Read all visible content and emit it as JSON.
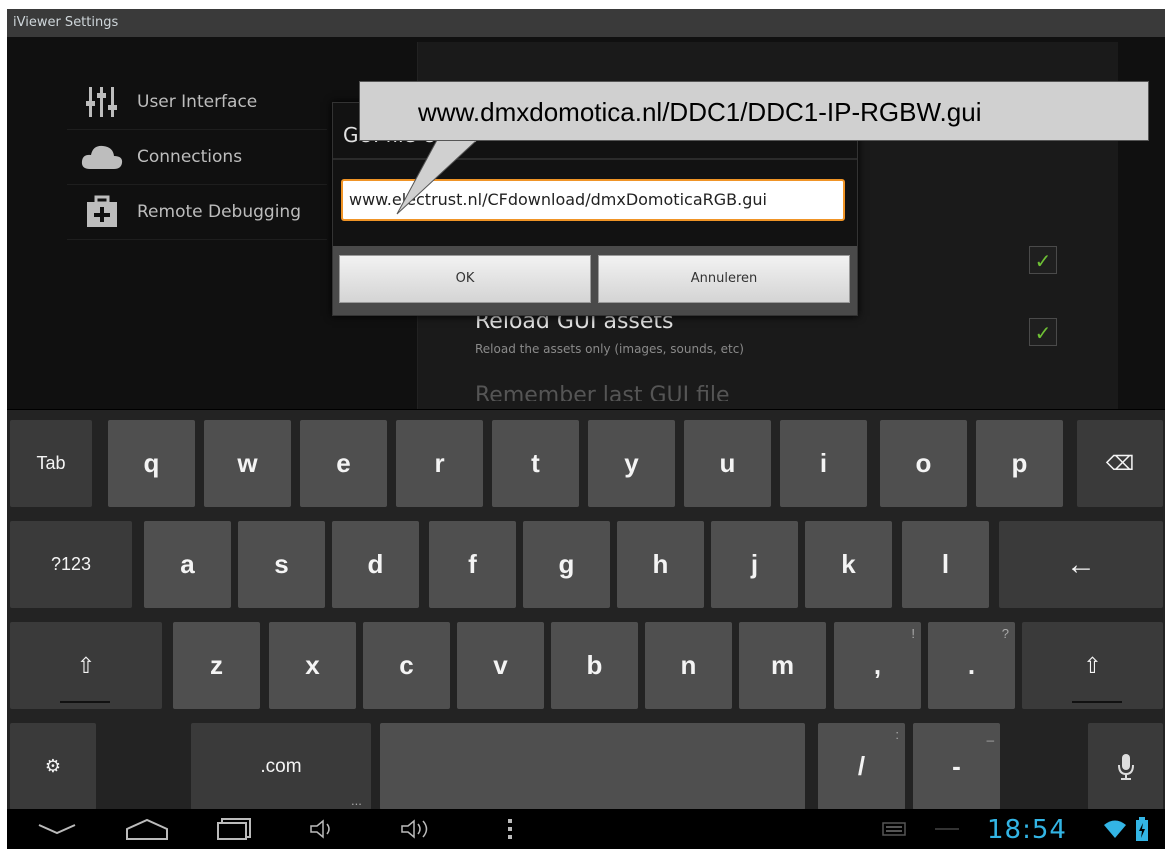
{
  "window": {
    "title": "iViewer Settings"
  },
  "sidebar": {
    "items": [
      {
        "label": "User Interface",
        "icon": "sliders-icon"
      },
      {
        "label": "Connections",
        "icon": "cloud-icon"
      },
      {
        "label": "Remote Debugging",
        "icon": "first-aid-kit-icon"
      }
    ]
  },
  "preferences": {
    "reload_title": "Reload GUI assets",
    "reload_subtitle": "Reload the assets only (images, sounds, etc)",
    "remember_title": "Remember last GUI file",
    "checkbox_mark": "✓"
  },
  "dialog": {
    "title": "GUI file URL",
    "input_value": "www.electrust.nl/CFdownload/dmxDomoticaRGB.gui",
    "ok_label": "OK",
    "cancel_label": "Annuleren"
  },
  "callout": {
    "text": "www.dmxdomotica.nl/DDC1/DDC1-IP-RGBW.gui"
  },
  "keyboard": {
    "row1": [
      "Tab",
      "q",
      "w",
      "e",
      "r",
      "t",
      "y",
      "u",
      "i",
      "o",
      "p"
    ],
    "backspace": "⌫",
    "row2": [
      "?123",
      "a",
      "s",
      "d",
      "f",
      "g",
      "h",
      "j",
      "k",
      "l"
    ],
    "enter": "←",
    "shift": "⇧",
    "row3": [
      "z",
      "x",
      "c",
      "v",
      "b",
      "n",
      "m",
      ",",
      "."
    ],
    "row3_hints": {
      "comma": "!",
      "period": "?"
    },
    "settings_icon": "⚙",
    "dotcom": ".com",
    "dotcom_hint": "...",
    "slash": "/",
    "slash_hint": ":",
    "dash": "-",
    "dash_hint": "_",
    "mic_icon": "🎤"
  },
  "navbar": {
    "time": "18:54",
    "accent": "#33b5e5"
  }
}
